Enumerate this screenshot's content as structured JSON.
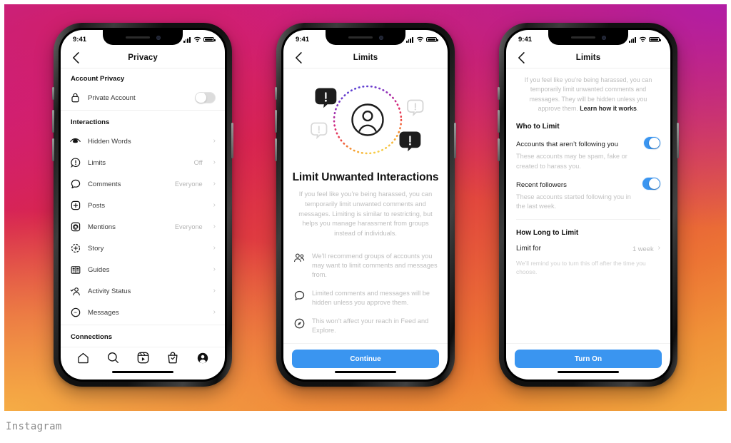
{
  "caption": "Instagram",
  "theme": {
    "accent_blue": "#3a95f0",
    "gradient_start": "#c0229c",
    "gradient_mid": "#d8254f",
    "gradient_end": "#f2a93f",
    "text_dark": "#111111",
    "text_muted": "#bdbdbd"
  },
  "phones": [
    {
      "status_bar": {
        "time": "9:41",
        "signal": "cellular-bars-icon",
        "wifi": "wifi-icon",
        "battery": "battery-full-icon"
      },
      "nav": {
        "back": "chevron-left-icon",
        "title": "Privacy"
      },
      "sections": [
        {
          "header": "Account Privacy",
          "rows": [
            {
              "icon": "lock-icon",
              "label": "Private Account",
              "control": "toggle",
              "state": "off"
            }
          ]
        },
        {
          "header": "Interactions",
          "rows": [
            {
              "icon": "hidden-words-eye-icon",
              "label": "Hidden Words",
              "value": "",
              "control": "chevron"
            },
            {
              "icon": "limits-exclamation-icon",
              "label": "Limits",
              "value": "Off",
              "control": "chevron"
            },
            {
              "icon": "comment-bubble-icon",
              "label": "Comments",
              "value": "Everyone",
              "control": "chevron"
            },
            {
              "icon": "plus-square-icon",
              "label": "Posts",
              "value": "",
              "control": "chevron"
            },
            {
              "icon": "at-mention-icon",
              "label": "Mentions",
              "value": "Everyone",
              "control": "chevron"
            },
            {
              "icon": "story-plus-icon",
              "label": "Story",
              "value": "",
              "control": "chevron"
            },
            {
              "icon": "guides-book-icon",
              "label": "Guides",
              "value": "",
              "control": "chevron"
            },
            {
              "icon": "activity-status-icon",
              "label": "Activity Status",
              "value": "",
              "control": "chevron"
            },
            {
              "icon": "messenger-icon",
              "label": "Messages",
              "value": "",
              "control": "chevron"
            }
          ]
        },
        {
          "header": "Connections",
          "rows": []
        }
      ],
      "tabbar": [
        {
          "icon": "home-icon",
          "name": "tab-home"
        },
        {
          "icon": "search-icon",
          "name": "tab-search"
        },
        {
          "icon": "reels-icon",
          "name": "tab-reels"
        },
        {
          "icon": "shop-bag-icon",
          "name": "tab-shop"
        },
        {
          "icon": "profile-avatar-icon",
          "name": "tab-profile"
        }
      ]
    },
    {
      "status_bar": {
        "time": "9:41"
      },
      "nav": {
        "back": "chevron-left-icon",
        "title": "Limits"
      },
      "illustration": "limit-unwanted-interactions-illustration",
      "title": "Limit Unwanted Interactions",
      "body": "If you feel like you’re being harassed, you can temporarily limit unwanted comments and messages. Limiting is similar to restricting, but helps you manage harassment from groups instead of individuals.",
      "features": [
        {
          "icon": "group-people-icon",
          "text": "We’ll recommend groups of accounts you may want to limit comments and messages from."
        },
        {
          "icon": "comment-bubble-icon",
          "text": "Limited comments and messages will be hidden unless you approve them."
        },
        {
          "icon": "compass-explore-icon",
          "text": "This won’t affect your reach in Feed and Explore."
        }
      ],
      "cta": "Continue"
    },
    {
      "status_bar": {
        "time": "9:41"
      },
      "nav": {
        "back": "chevron-left-icon",
        "title": "Limits"
      },
      "intro_text": "If you feel like you’re being harassed, you can temporarily limit unwanted comments and messages. They will be hidden unless you approve them. ",
      "intro_link": "Learn how it works",
      "intro_tail": ".",
      "who_header": "Who to Limit",
      "options": [
        {
          "title": "Accounts that aren’t following you",
          "desc": "These accounts may be spam, fake or created to harass you.",
          "state": "on"
        },
        {
          "title": "Recent followers",
          "desc": "These accounts started following you in the last week.",
          "state": "on"
        }
      ],
      "how_long_header": "How Long to Limit",
      "limit_for_label": "Limit for",
      "limit_for_value": "1 week",
      "reminder_note": "We’ll remind you to turn this off after the time you choose.",
      "cta": "Turn On"
    }
  ]
}
